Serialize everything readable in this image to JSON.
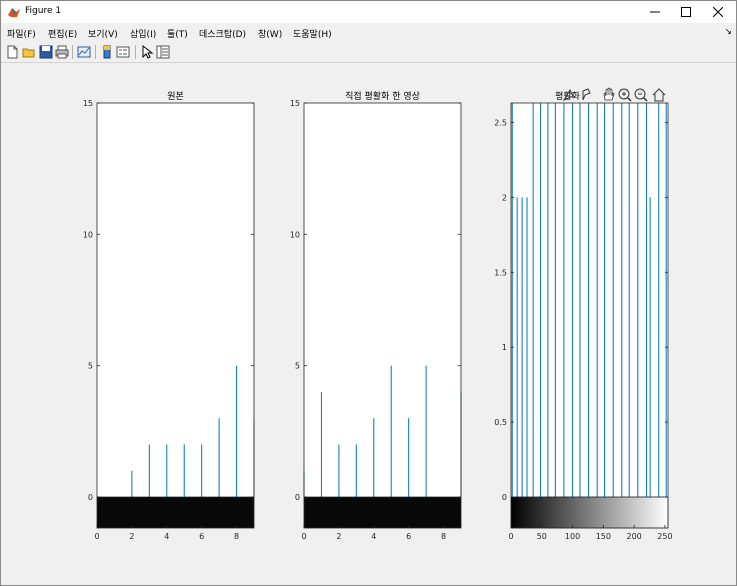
{
  "window": {
    "title": "Figure 1"
  },
  "menu": [
    {
      "label": "파일(F)"
    },
    {
      "label": "편집(E)"
    },
    {
      "label": "보기(V)"
    },
    {
      "label": "삽입(I)"
    },
    {
      "label": "툴(T)"
    },
    {
      "label": "데스크탑(D)"
    },
    {
      "label": "창(W)"
    },
    {
      "label": "도움말(H)"
    }
  ],
  "toolbar_icons": [
    "new-figure-icon",
    "open-file-icon",
    "save-icon",
    "print-icon",
    "link-plot-icon",
    "insert-colorbar-icon",
    "insert-legend-icon",
    "edit-plot-arrow-icon",
    "property-inspector-icon"
  ],
  "axes_toolbar_icons": [
    "data-tip-icon",
    "brush-icon",
    "pan-icon",
    "zoom-in-icon",
    "zoom-out-icon",
    "home-icon"
  ],
  "colors": {
    "stem": "#0072bd",
    "title_bg": "#ffffff",
    "figure_bg": "#f0f0f0"
  },
  "chart_data": [
    {
      "type": "bar",
      "title": "원본",
      "xlim": [
        0,
        9
      ],
      "ylim": [
        0,
        15
      ],
      "xticks": [
        0,
        2,
        4,
        6,
        8
      ],
      "yticks": [
        0,
        5,
        10,
        15
      ],
      "x": [
        0,
        1,
        2,
        3,
        4,
        5,
        6,
        7,
        8,
        9
      ],
      "values": [
        0,
        0,
        1,
        2,
        2,
        2,
        2,
        3,
        5,
        3
      ],
      "colorbar": {
        "range": [
          0,
          9
        ],
        "gradient": "black"
      }
    },
    {
      "type": "bar",
      "title": "직접 평활화 한 영상",
      "xlim": [
        0,
        9
      ],
      "ylim": [
        0,
        15
      ],
      "xticks": [
        0,
        2,
        4,
        6,
        8
      ],
      "yticks": [
        0,
        5,
        10,
        15
      ],
      "x": [
        0,
        1,
        2,
        3,
        4,
        5,
        6,
        7,
        8,
        9
      ],
      "values": [
        1,
        4,
        2,
        2,
        3,
        5,
        3,
        5,
        0,
        4
      ],
      "colorbar": {
        "range": [
          0,
          9
        ],
        "gradient": "black"
      }
    },
    {
      "type": "bar",
      "title": "평활화",
      "xlim": [
        0,
        255
      ],
      "ylim": [
        0,
        2.6
      ],
      "xticks": [
        0,
        50,
        100,
        150,
        200,
        250
      ],
      "yticks": [
        0,
        0.5,
        1,
        1.5,
        2,
        2.5
      ],
      "ytick_labels": [
        "0",
        "0.5",
        "1",
        "1.5",
        "2",
        "2.5"
      ],
      "x": [
        2,
        10,
        18,
        26,
        36,
        48,
        60,
        72,
        86,
        100,
        112,
        126,
        140,
        152,
        166,
        180,
        192,
        206,
        220,
        226,
        240,
        252
      ],
      "values": [
        3,
        2,
        2,
        2,
        3,
        3,
        3,
        3,
        3,
        3,
        3,
        3,
        3,
        3,
        3,
        3,
        3,
        3,
        3,
        2,
        3,
        3
      ],
      "colorbar": {
        "range": [
          0,
          255
        ],
        "gradient": "black-to-white"
      }
    }
  ]
}
